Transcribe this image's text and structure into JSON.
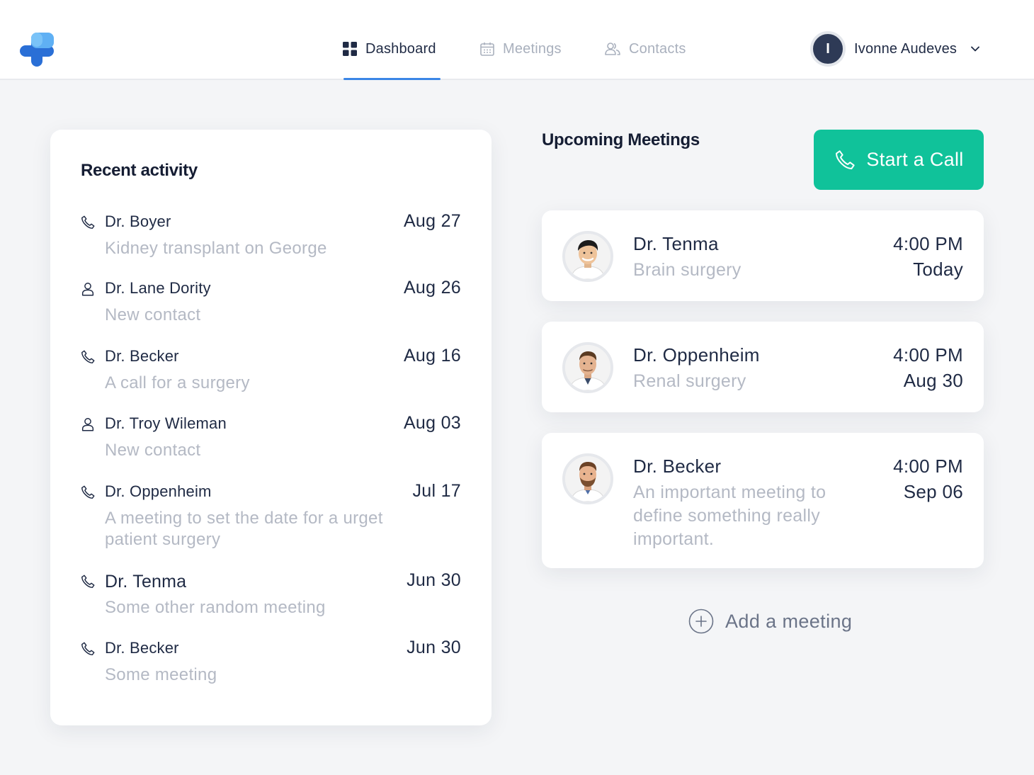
{
  "nav": {
    "tabs": [
      {
        "label": "Dashboard",
        "icon": "grid-icon",
        "active": true
      },
      {
        "label": "Meetings",
        "icon": "calendar-icon",
        "active": false
      },
      {
        "label": "Contacts",
        "icon": "contacts-icon",
        "active": false
      }
    ]
  },
  "user": {
    "initial": "I",
    "name": "Ivonne Audeves"
  },
  "recent_activity": {
    "title": "Recent activity",
    "items": [
      {
        "icon": "phone-icon",
        "name": "Dr. Boyer",
        "date": "Aug 27",
        "description": "Kidney transplant on George"
      },
      {
        "icon": "person-icon",
        "name": "Dr. Lane Dority",
        "date": "Aug 26",
        "description": "New contact"
      },
      {
        "icon": "phone-icon",
        "name": "Dr. Becker",
        "date": "Aug 16",
        "description": "A call for a surgery"
      },
      {
        "icon": "person-icon",
        "name": "Dr. Troy Wileman",
        "date": "Aug 03",
        "description": "New contact"
      },
      {
        "icon": "phone-icon",
        "name": "Dr. Oppenheim",
        "date": "Jul 17",
        "description": "A meeting to set the date for a urget patient surgery"
      },
      {
        "icon": "phone-icon",
        "name": "Dr. Tenma",
        "date": "Jun 30",
        "description": "Some other random meeting"
      },
      {
        "icon": "phone-icon",
        "name": "Dr. Becker",
        "date": "Jun 30",
        "description": "Some meeting"
      }
    ]
  },
  "upcoming": {
    "title": "Upcoming Meetings",
    "start_call_label": "Start a Call",
    "meetings": [
      {
        "name": "Dr. Tenma",
        "description": "Brain surgery",
        "time": "4:00 PM",
        "when": "Today"
      },
      {
        "name": "Dr. Oppenheim",
        "description": "Renal surgery",
        "time": "4:00 PM",
        "when": "Aug 30"
      },
      {
        "name": "Dr. Becker",
        "description": "An important meeting to define something really important.",
        "time": "4:00 PM",
        "when": "Sep 06"
      }
    ],
    "add_label": "Add a meeting"
  },
  "colors": {
    "accent_blue": "#3a86e6",
    "call_green": "#10c29a",
    "text_dark": "#1f2a44",
    "text_muted": "#b4b9c4"
  }
}
